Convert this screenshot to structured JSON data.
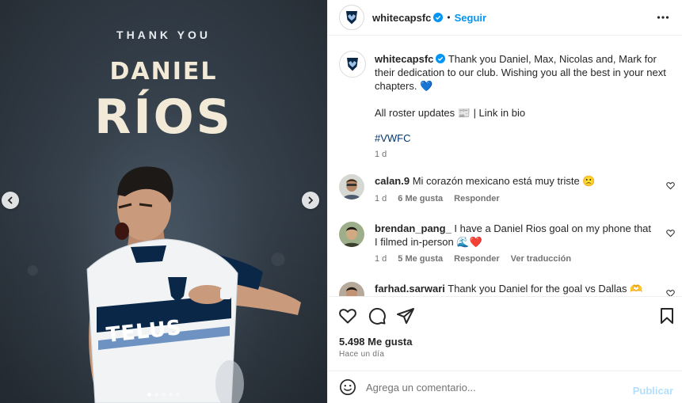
{
  "media": {
    "overline": "THANK YOU",
    "first_name": "DANIEL",
    "last_name": "RÍOS",
    "shirt_sponsor": "TELUS",
    "carousel": {
      "total": 5,
      "active": 1
    }
  },
  "header": {
    "username": "whitecapsfc",
    "separator": "•",
    "follow_label": "Seguir",
    "more_icon": "more-horizontal-icon"
  },
  "caption": {
    "username": "whitecapsfc",
    "text": "Thank you Daniel, Max, Nicolas and, Mark for their dedication to our club. Wishing you all the best in your next chapters. 💙",
    "roster_line": "All roster updates 📰 | Link in bio",
    "hashtag": "#VWFC",
    "time": "1 d"
  },
  "comments": [
    {
      "username": "calan.9",
      "text": "Mi corazón mexicano está muy triste 🙁",
      "time": "1 d",
      "likes": "6 Me gusta",
      "reply": "Responder",
      "translate": ""
    },
    {
      "username": "brendan_pang_",
      "text": "I have a Daniel Rios goal on my phone that I filmed in-person 🌊❤️",
      "time": "1 d",
      "likes": "5 Me gusta",
      "reply": "Responder",
      "translate": "Ver traducción"
    },
    {
      "username": "farhad.sarwari",
      "text": "Thank you Daniel for the goal vs Dallas 🫶",
      "time": "",
      "likes": "",
      "reply": "",
      "translate": ""
    }
  ],
  "stats": {
    "likes": "5.498 Me gusta",
    "ago": "Hace un día"
  },
  "composer": {
    "placeholder": "Agrega un comentario...",
    "publish_label": "Publicar"
  },
  "colors": {
    "accent": "#0095f6",
    "publish_disabled": "#b2dffc",
    "muted": "#737373",
    "hashtag": "#00376b"
  }
}
